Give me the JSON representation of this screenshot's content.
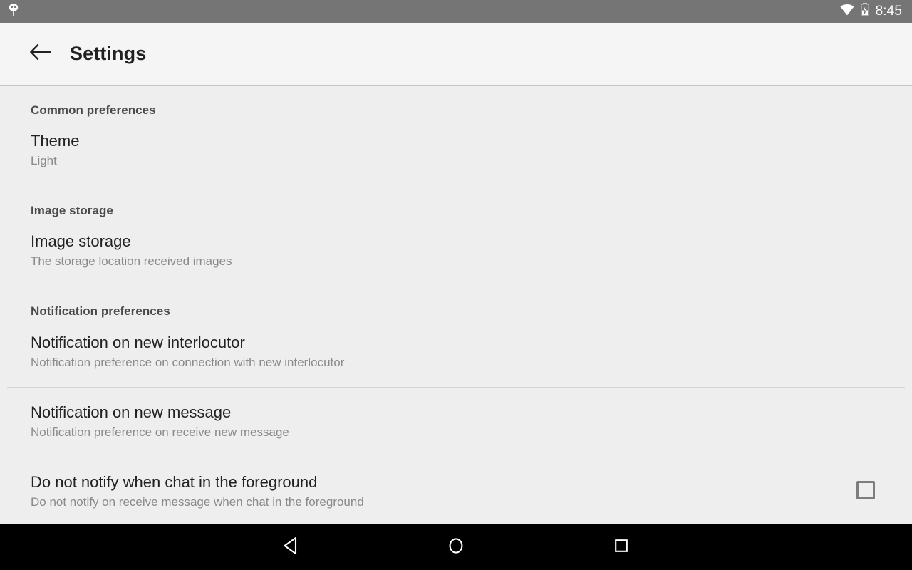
{
  "status_bar": {
    "notification_icon": "android-robot-icon",
    "wifi_icon": "wifi-icon",
    "battery_icon": "battery-charging-icon",
    "clock": "8:45",
    "background_color": "#757575",
    "foreground_color": "#ffffff"
  },
  "app_bar": {
    "back_icon": "arrow-left-icon",
    "title": "Settings",
    "background_color": "#f5f5f5"
  },
  "settings": {
    "sections": [
      {
        "header": "Common preferences",
        "items": [
          {
            "title": "Theme",
            "summary": "Light",
            "control": "none",
            "divider_after": false
          }
        ]
      },
      {
        "header": "Image storage",
        "items": [
          {
            "title": "Image storage",
            "summary": "The storage location received images",
            "control": "none",
            "divider_after": false
          }
        ]
      },
      {
        "header": "Notification preferences",
        "items": [
          {
            "title": "Notification on new interlocutor",
            "summary": "Notification preference on connection with new interlocutor",
            "control": "none",
            "divider_after": true
          },
          {
            "title": "Notification on new message",
            "summary": "Notification preference on receive new message",
            "control": "none",
            "divider_after": true
          },
          {
            "title": "Do not notify when chat in the foreground",
            "summary": "Do not notify on receive message when chat in the foreground",
            "control": "checkbox",
            "checked": false,
            "divider_after": false
          }
        ]
      }
    ]
  },
  "nav_bar": {
    "back_label": "back-triangle-icon",
    "home_label": "home-circle-icon",
    "recents_label": "recents-square-icon",
    "background_color": "#000000"
  },
  "theme": {
    "page_background": "#eeeeee",
    "title_color": "#212121",
    "summary_color": "#8a8a8a",
    "section_header_color": "#4a4a4a",
    "divider_color": "#d3d3d3"
  }
}
